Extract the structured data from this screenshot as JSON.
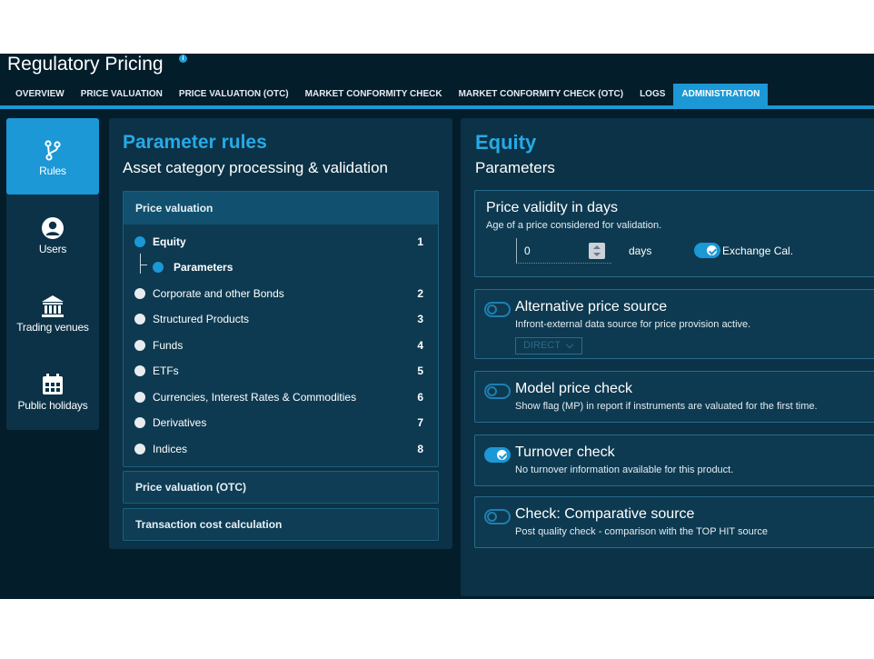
{
  "header": {
    "title": "Regulatory Pricing",
    "info_icon": "info-icon"
  },
  "tabs": [
    {
      "label": "OVERVIEW",
      "active": false
    },
    {
      "label": "PRICE VALUATION",
      "active": false
    },
    {
      "label": "PRICE VALUATION (OTC)",
      "active": false
    },
    {
      "label": "MARKET CONFORMITY CHECK",
      "active": false
    },
    {
      "label": "MARKET CONFORMITY CHECK (OTC)",
      "active": false
    },
    {
      "label": "LOGS",
      "active": false
    },
    {
      "label": "ADMINISTRATION",
      "active": true
    }
  ],
  "sidebar": {
    "items": [
      {
        "label": "Rules",
        "icon": "branch-icon",
        "active": true
      },
      {
        "label": "Users",
        "icon": "user-icon",
        "active": false
      },
      {
        "label": "Trading venues",
        "icon": "bank-icon",
        "active": false
      },
      {
        "label": "Public holidays",
        "icon": "calendar-icon",
        "active": false
      }
    ]
  },
  "rules_panel": {
    "title": "Parameter rules",
    "subtitle": "Asset category processing & validation",
    "price_valuation": {
      "header": "Price valuation",
      "categories": [
        {
          "label": "Equity",
          "num": "1",
          "selected": true
        },
        {
          "label": "Parameters",
          "sub": true
        },
        {
          "label": "Corporate and other Bonds",
          "num": "2"
        },
        {
          "label": "Structured Products",
          "num": "3"
        },
        {
          "label": "Funds",
          "num": "4"
        },
        {
          "label": "ETFs",
          "num": "5"
        },
        {
          "label": "Currencies, Interest Rates & Commodities",
          "num": "6"
        },
        {
          "label": "Derivatives",
          "num": "7"
        },
        {
          "label": "Indices",
          "num": "8"
        }
      ]
    },
    "price_valuation_otc": "Price valuation (OTC)",
    "transaction_cost": "Transaction cost calculation"
  },
  "equity_panel": {
    "title": "Equity",
    "subtitle": "Parameters",
    "price_validity": {
      "title": "Price validity in days",
      "desc": "Age of a price considered for validation.",
      "days_value": "0",
      "days_label": "days",
      "exchange_label": "Exchange Cal.",
      "exchange_on": true
    },
    "alt_source": {
      "title": "Alternative price source",
      "desc": "Infront-external data source for price provision active.",
      "select_value": "DIRECT",
      "on": false
    },
    "model_check": {
      "title": "Model price check",
      "desc": "Show flag (MP) in report if instruments are valuated for the first time.",
      "on": false
    },
    "turnover_check": {
      "title": "Turnover check",
      "desc": "No turnover information available for this product.",
      "on": true
    },
    "comparative": {
      "title": "Check: Comparative source",
      "desc": "Post quality check - comparison with the TOP HIT source",
      "on": false
    }
  },
  "colors": {
    "accent": "#1b98d5",
    "title_blue": "#27a9e6",
    "background": "#041d2b",
    "panel": "#0b3246"
  }
}
